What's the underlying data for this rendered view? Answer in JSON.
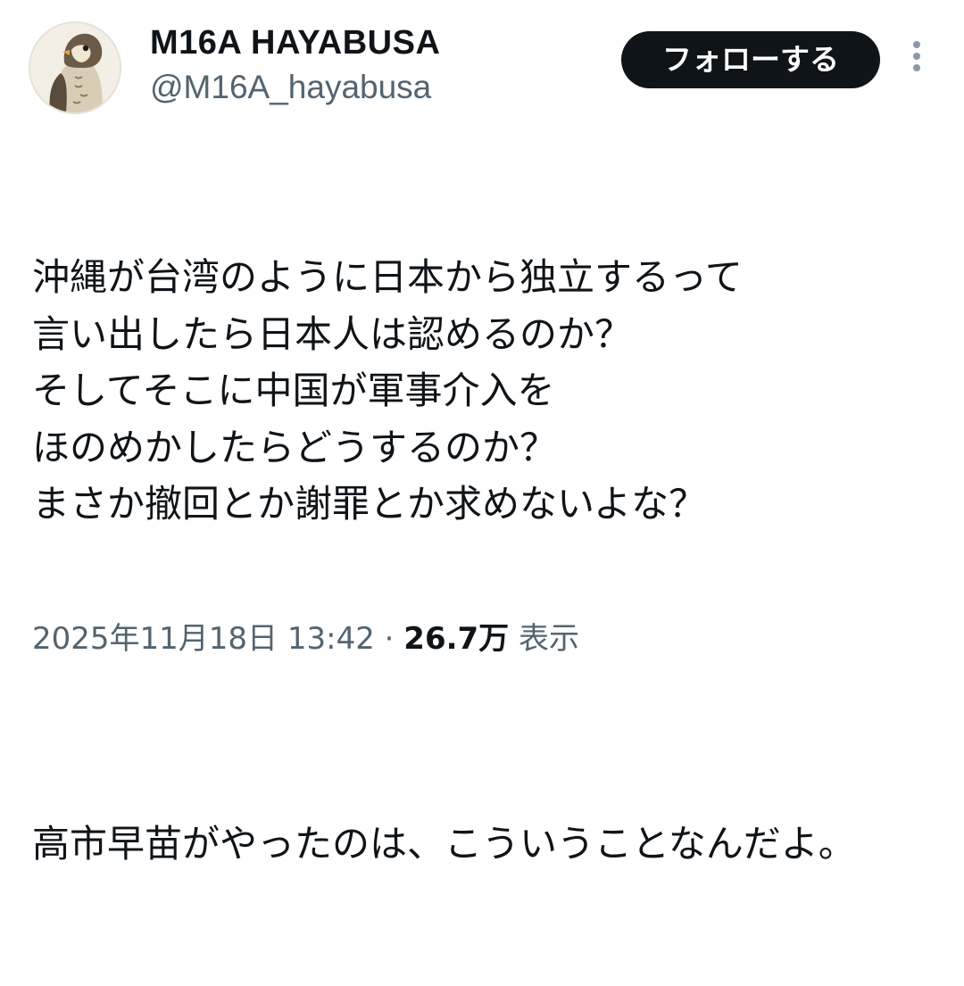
{
  "author": {
    "display_name": "M16A  HAYABUSA",
    "handle": "@M16A_hayabusa",
    "avatar_icon": "falcon-avatar-icon"
  },
  "actions": {
    "follow_label": "フォローする",
    "more_icon": "more-vertical-icon"
  },
  "tweet": {
    "paragraph_1": "沖縄が台湾のように日本から独立するって\n言い出したら日本人は認めるのか？\nそしてそこに中国が軍事介入を\nほのめかしたらどうするのか？\nまさか撤回とか謝罪とか求めないよな？",
    "paragraph_2": "高市早苗がやったのは、こういうことなんだよ。"
  },
  "meta": {
    "timestamp": "2025年11月18日 13:42",
    "separator": "·",
    "views_count": "26.7万",
    "views_label": "表示"
  },
  "colors": {
    "text_primary": "#0f1419",
    "text_secondary": "#536471",
    "follow_button_bg": "#0f1419",
    "follow_button_text": "#ffffff"
  }
}
